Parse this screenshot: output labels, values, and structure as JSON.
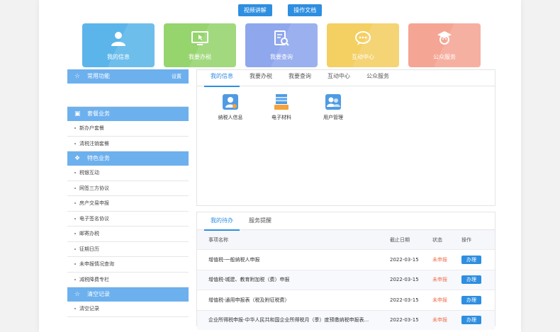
{
  "top_buttons": [
    "视频讲解",
    "操作文档"
  ],
  "cards": [
    {
      "label": "我的信息",
      "icon": "user-icon",
      "color": "#5bb5ea"
    },
    {
      "label": "我要办税",
      "icon": "monitor-icon",
      "color": "#96d46e"
    },
    {
      "label": "我要查询",
      "icon": "search-doc-icon",
      "color": "#8ea7ed"
    },
    {
      "label": "互动中心",
      "icon": "chat-icon",
      "color": "#f4cf62"
    },
    {
      "label": "公众服务",
      "icon": "service-icon",
      "color": "#f5a594"
    }
  ],
  "sidebar": {
    "common": {
      "title": "常用功能",
      "settings": "设置"
    },
    "packages": {
      "title": "套餐业务",
      "items": [
        "新办户套餐",
        "清税注销套餐"
      ]
    },
    "special": {
      "title": "特色业务",
      "items": [
        "税银互动",
        "网签三方协议",
        "房产交易申报",
        "电子签名协议",
        "邮寄办税",
        "征期日历",
        "未申报情况查询",
        "减税降费专栏"
      ]
    },
    "clear": {
      "title": "清空记录",
      "items": [
        "清空记录"
      ]
    }
  },
  "info_panel": {
    "tabs": [
      "我的信息",
      "我要办税",
      "我要查询",
      "互动中心",
      "公众服务"
    ],
    "quick_items": [
      {
        "label": "纳税人信息",
        "icon": "taxpayer-icon"
      },
      {
        "label": "电子材料",
        "icon": "documents-icon"
      },
      {
        "label": "用户管理",
        "icon": "user-manage-icon"
      }
    ]
  },
  "todo_panel": {
    "tabs": [
      "我的待办",
      "服务提醒"
    ],
    "headers": [
      "事项名称",
      "截止日期",
      "状态",
      "操作"
    ],
    "rows": [
      {
        "name": "增值税-一般纳税人申报",
        "date": "2022-03-15",
        "status": "未申报",
        "action": "办理"
      },
      {
        "name": "增值税-城建、教育附加税（费）申报",
        "date": "2022-03-15",
        "status": "未申报",
        "action": "办理"
      },
      {
        "name": "增值税-通用申报表（税及附征税费）",
        "date": "2022-03-15",
        "status": "未申报",
        "action": "办理"
      },
      {
        "name": "企业所得税申报-中华人民共和国企业所得税月（季）度预缴纳税申报表...",
        "date": "2022-03-15",
        "status": "未申报",
        "action": "办理"
      }
    ]
  }
}
